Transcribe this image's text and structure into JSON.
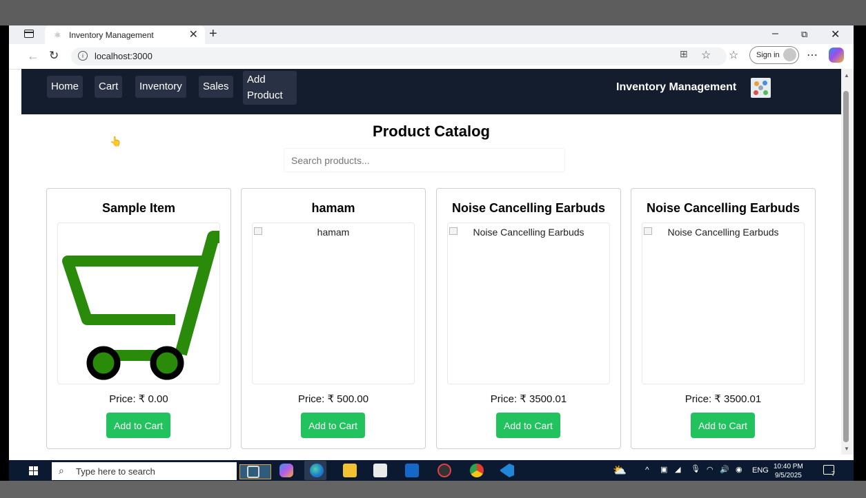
{
  "browser": {
    "tab_title": "Inventory Management",
    "tab_close": "✕",
    "new_tab": "+",
    "url": "localhost:3000",
    "sign_in": "Sign in",
    "more": "⋯",
    "window_controls": {
      "minimize": "–",
      "restore": "⧉",
      "close": "✕"
    }
  },
  "app": {
    "nav": [
      "Home",
      "Cart",
      "Inventory",
      "Sales",
      "Add Product"
    ],
    "brand": "Inventory Management",
    "page_title": "Product Catalog",
    "search_placeholder": "Search products...",
    "products": [
      {
        "name": "Sample Item",
        "image": "cart-icon",
        "alt": "",
        "price": "Price: ₹ 0.00",
        "button": "Add to Cart"
      },
      {
        "name": "hamam",
        "image": "broken-image",
        "alt": "hamam",
        "price": "Price: ₹ 500.00",
        "button": "Add to Cart"
      },
      {
        "name": "Noise Cancelling Earbuds",
        "image": "broken-image",
        "alt": "Noise Cancelling Earbuds",
        "price": "Price: ₹ 3500.01",
        "button": "Add to Cart"
      },
      {
        "name": "Noise Cancelling Earbuds",
        "image": "broken-image",
        "alt": "Noise Cancelling Earbuds",
        "price": "Price: ₹ 3500.01",
        "button": "Add to Cart"
      }
    ]
  },
  "taskbar": {
    "search_placeholder": "Type here to search",
    "language": "ENG",
    "time": "10:40 PM",
    "date": "9/5/2025",
    "notification_count": "7"
  },
  "colors": {
    "nav_bg": "#141d2e",
    "nav_button_bg": "#283244",
    "add_button": "#22c25e",
    "cart_icon_green": "#2a8a0a"
  }
}
